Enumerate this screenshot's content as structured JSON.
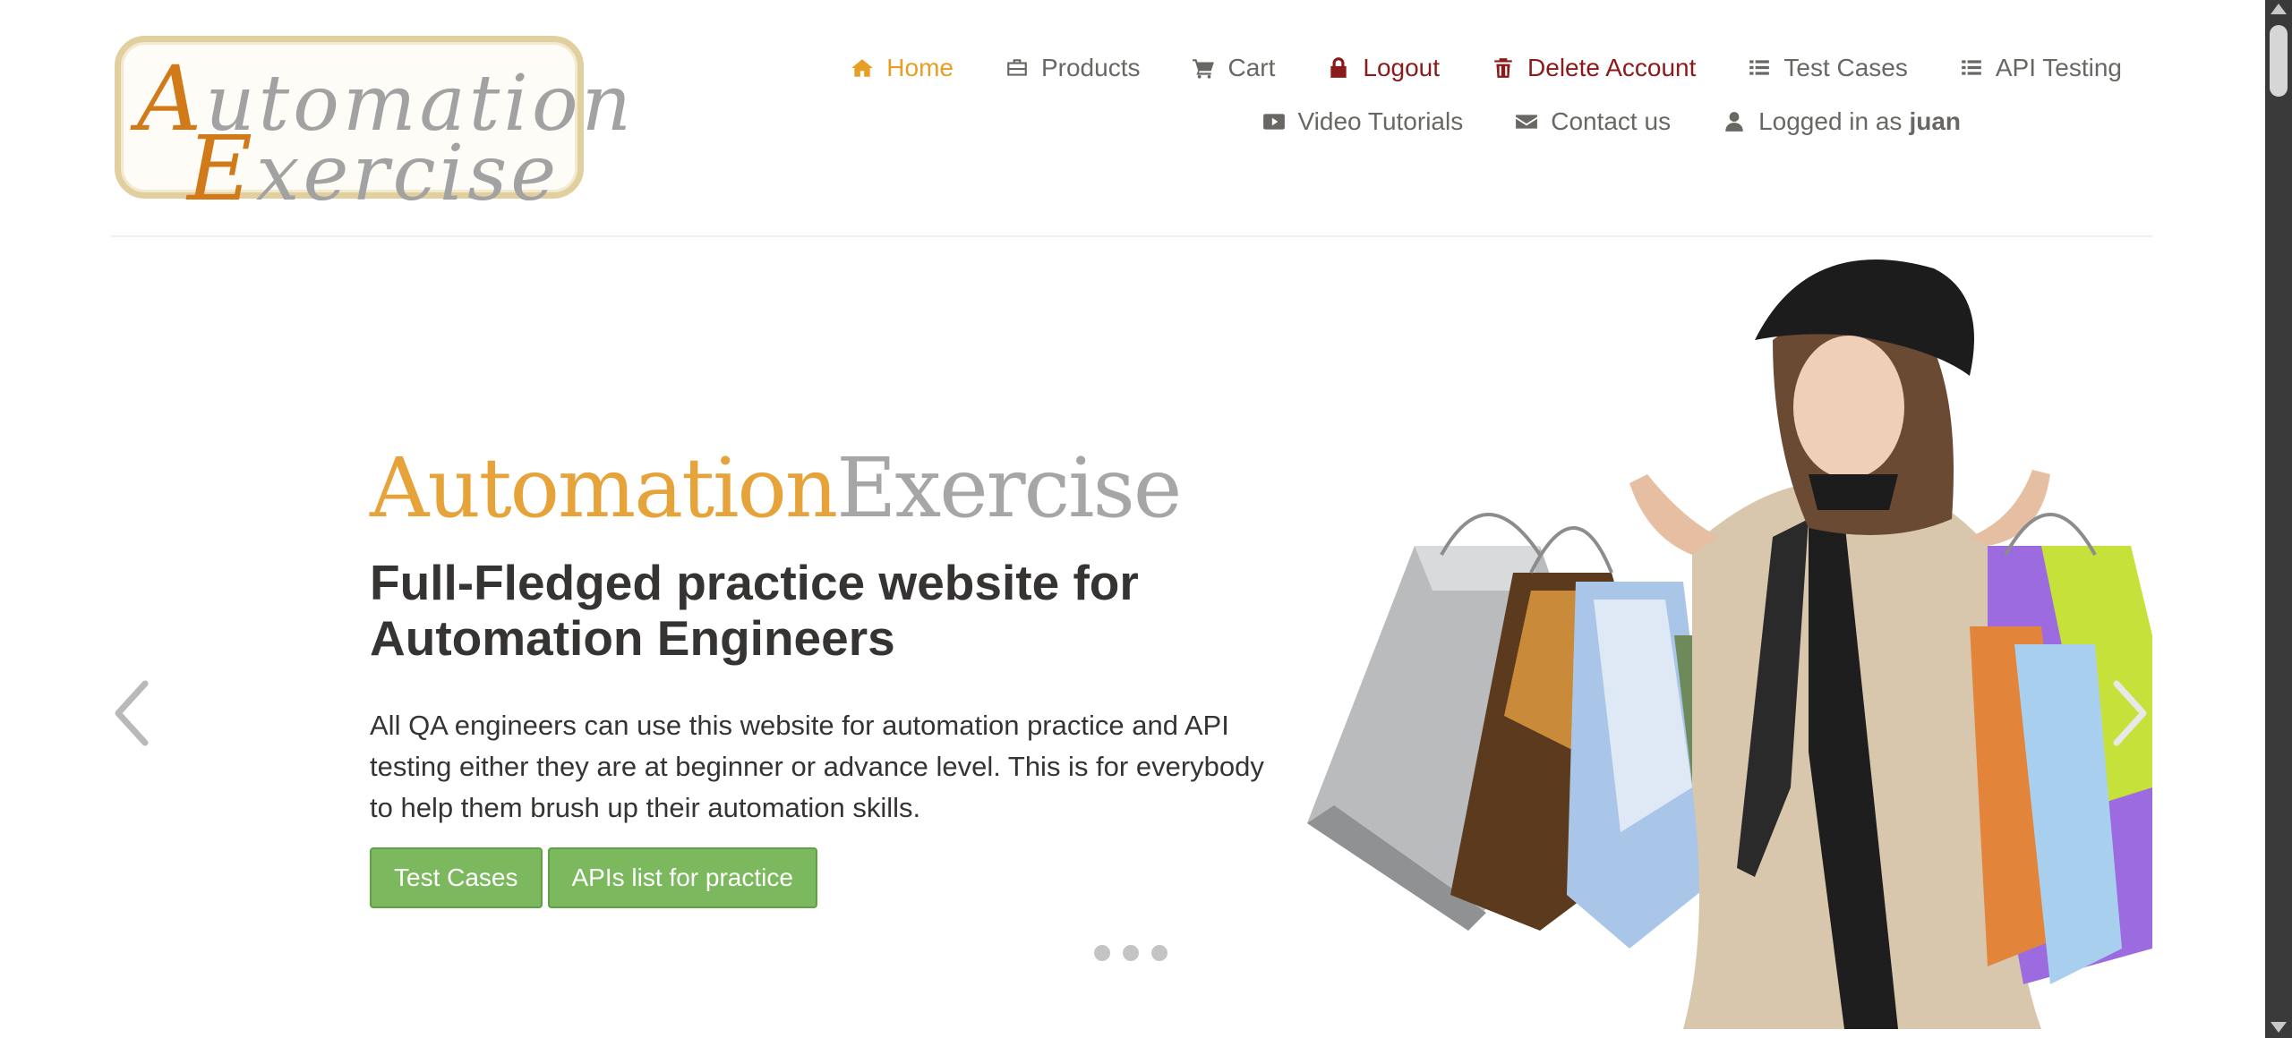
{
  "header": {
    "logo": {
      "line1_cap": "A",
      "line1_rest": "utomation",
      "line2_cap": "E",
      "line2_rest": "xercise"
    },
    "nav_primary": [
      {
        "label": "Home",
        "icon": "home-icon"
      },
      {
        "label": "Products",
        "icon": "briefcase-icon"
      },
      {
        "label": "Cart",
        "icon": "cart-icon"
      },
      {
        "label": "Logout",
        "icon": "lock-icon"
      },
      {
        "label": "Delete Account",
        "icon": "trash-icon"
      },
      {
        "label": "Test Cases",
        "icon": "list-icon"
      },
      {
        "label": "API Testing",
        "icon": "list-icon"
      }
    ],
    "nav_secondary": [
      {
        "label": "Video Tutorials",
        "icon": "youtube-play-icon"
      },
      {
        "label": "Contact us",
        "icon": "envelope-icon"
      },
      {
        "label": "Logged in as",
        "icon": "user-icon",
        "username": "juan"
      }
    ],
    "active_item": "Home"
  },
  "slider": {
    "brand_orange": "Automation",
    "brand_grey": "Exercise",
    "title": "Full-Fledged practice website for Automation Engineers",
    "text": "All QA engineers can use this website for automation practice and API testing either they are at beginner or advance level. This is for everybody to help them brush up their automation skills.",
    "buttons": [
      "Test Cases",
      "APIs list for practice"
    ],
    "slide_count": 3,
    "image": "woman-with-shopping-bags-image"
  },
  "colors": {
    "accent_orange": "#e79e24",
    "danger_red": "#8b1a1a",
    "button_green": "#7cb85e",
    "text_dark": "#363432",
    "text_nav": "#696763"
  }
}
